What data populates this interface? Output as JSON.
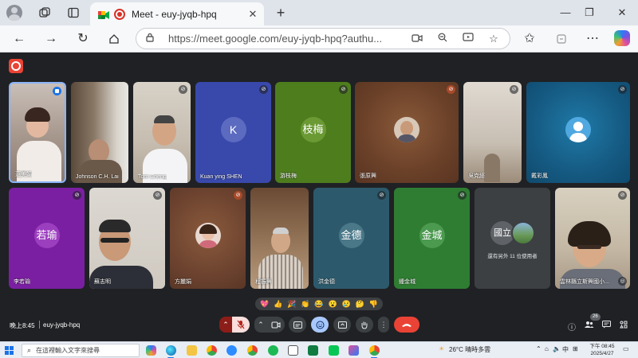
{
  "browser": {
    "tab_title": "Meet - euy-jyqb-hpq",
    "tab_close": "✕",
    "new_tab": "+",
    "url": "https://meet.google.com/euy-jyqb-hpq?authu...",
    "window_controls": [
      "—",
      "❐",
      "✕"
    ]
  },
  "meet": {
    "tiles": [
      {
        "name": "范美娟",
        "type": "video"
      },
      {
        "name": "Johnson C.H. Lai",
        "type": "video"
      },
      {
        "name": "Tom Cheng",
        "type": "video"
      },
      {
        "name": "Kuan ying SHEN",
        "type": "letter",
        "letter": "K"
      },
      {
        "name": "游枝梅",
        "type": "letter",
        "letter": "枝梅"
      },
      {
        "name": "張原興",
        "type": "avatar"
      },
      {
        "name": "吳克經",
        "type": "video"
      },
      {
        "name": "戴彩鳳",
        "type": "avatar"
      },
      {
        "name": "李若瑜",
        "type": "letter",
        "letter": "若瑜"
      },
      {
        "name": "蘇志明",
        "type": "video"
      },
      {
        "name": "方麗娟",
        "type": "avatar"
      },
      {
        "name": "程振興",
        "type": "video"
      },
      {
        "name": "洪金德",
        "type": "letter",
        "letter": "金德"
      },
      {
        "name": "鍾金城",
        "type": "letter",
        "letter": "金城"
      },
      {
        "name": "還有另外 11 位使用者",
        "type": "others",
        "letter": "國立"
      },
      {
        "name": "雲林縣立斯興國小...",
        "type": "video"
      }
    ],
    "reactions": [
      "💖",
      "👍",
      "🎉",
      "👏",
      "😂",
      "😮",
      "😢",
      "🤔",
      "👎"
    ],
    "time": "晚上8:45",
    "meeting_code": "euy-jyqb-hpq",
    "participant_count": "26"
  },
  "taskbar": {
    "search_placeholder": "在這裡輸入文字來搜尋",
    "weather": "26°C  晴時多雲",
    "ime": "中",
    "time": "下午 08:45",
    "date": "2025/4/27"
  }
}
